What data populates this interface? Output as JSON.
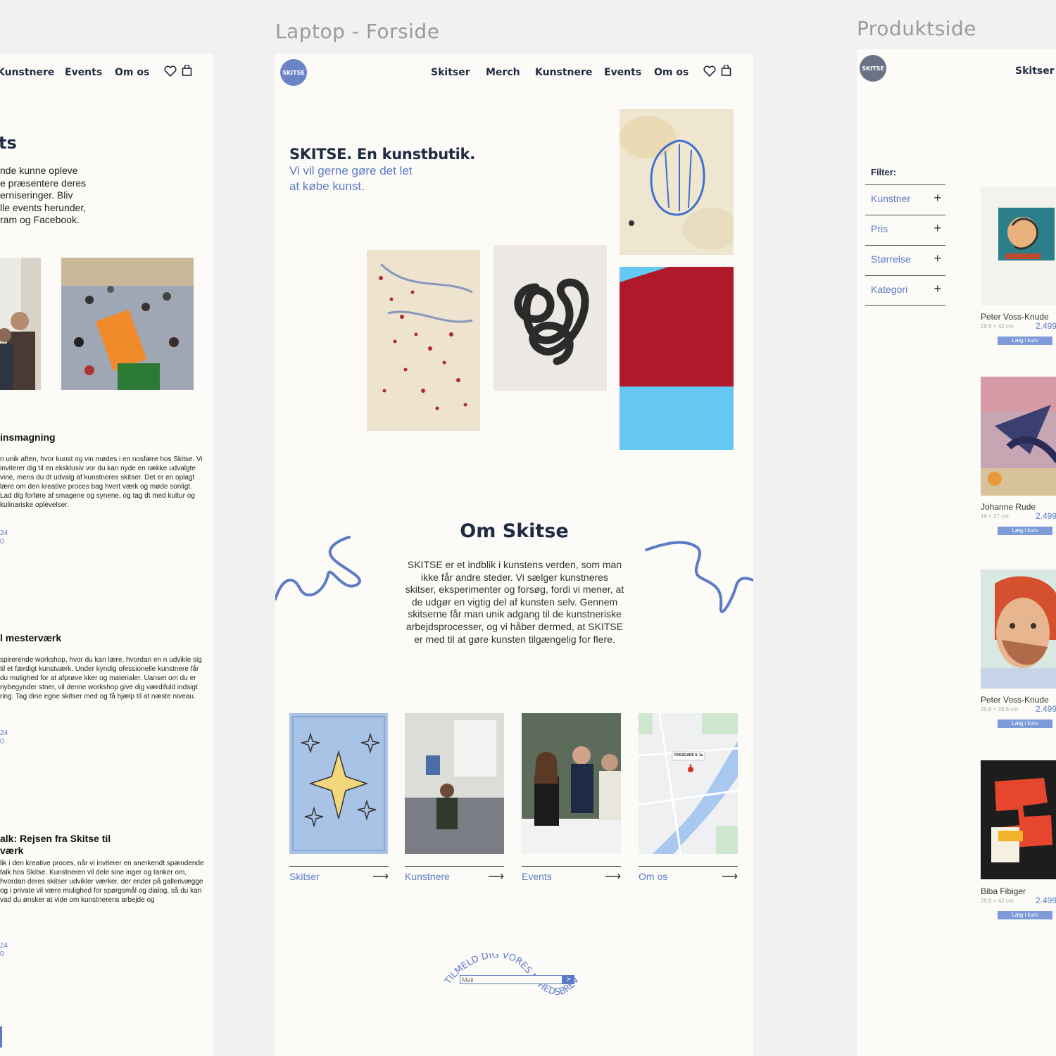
{
  "frames": {
    "laptop_title": "Laptop - Forside",
    "product_title": "Produktside"
  },
  "left": {
    "nav": {
      "kunstnere": "Kunstnere",
      "events": "Events",
      "omos": "Om os"
    },
    "heading": "ts",
    "intro": [
      "nde kunne opleve",
      "e præsentere deres",
      "erniseringer.  Bliv",
      "lle events herunder,",
      "ram og Facebook."
    ],
    "events": [
      {
        "title": "insmagning",
        "body": "n unik aften, hvor kunst og vin mødes i en nosfære hos Skitse. Vi inviterer dig til en eksklusiv vor du kan nyde en række udvalgte vine, mens du dt udvalg af kunstneres skitser. Det er en oplagt lære om den kreative proces bag hvert værk og møde sonligt. Lad dig forføre af smagene og synene, og tag dt med kultur og kulinariske oplevelser.",
        "date1": "24",
        "date2": "0"
      },
      {
        "title": "l mesterværk",
        "body": "spirerende workshop, hvor du kan lære, hvordan en n udvikle sig til et færdigt kunstværk. Under kyndig ofessionelle kunstnere får du mulighed for at afprøve kker og materialer. Uanset om du er nybegynder stner, vil denne workshop give dig værdifuld indsigt ring. Tag dine egne skitser med og få hjælp til at næste niveau.",
        "date1": "24",
        "date2": "0"
      },
      {
        "title": "alk: Rejsen fra Skitse til",
        "title2": "værk",
        "body": "lik i den kreative proces, når vi inviterer en anerkendt spændende talk hos Skitse. Kunstneren vil dele sine inger og tanker om, hvordan deres skitser udvikler værker, der ender på gallerivægge og i private vil være mulighed for spørgsmål og dialog, så du kan vad du ønsker at vide om kunstnerens arbejde og",
        "date1": "24",
        "date2": "0"
      }
    ]
  },
  "mid": {
    "logo": "SKITSE",
    "nav": {
      "skitser": "Skitser",
      "merch": "Merch",
      "kunstnere": "Kunstnere",
      "events": "Events",
      "omos": "Om os"
    },
    "hero_title": "SKITSE. En kunstbutik.",
    "hero_sub1": "Vi vil gerne gøre det let",
    "hero_sub2": "at købe kunst.",
    "about_title": "Om Skitse",
    "about_lines": [
      "SKITSE er et indblik i kunstens verden, som man",
      "ikke får andre steder. Vi sælger kunstneres",
      "skitser, eksperimenter og forsøg, fordi vi mener, at",
      "de udgør en vigtig del af kunsten selv. Gennem",
      "skitserne får man unik adgang til de kunstneriske",
      "arbejdsprocesser, og vi håber dermed, at SKITSE",
      "er med til at gøre kunsten tilgængelig for flere."
    ],
    "cards": [
      "Skitser",
      "Kunstnere",
      "Events",
      "Om os"
    ],
    "arrow": "⟶",
    "map_label": "RYESGADE 9, 1v",
    "newsletter_arc": "TILMELD DIG VORES NYHEDSBREV",
    "newsletter_placeholder": "Mail",
    "newsletter_go": ">"
  },
  "right": {
    "logo": "SKITSE",
    "nav_skitser": "Skitser",
    "filter_label": "Filter:",
    "filters": [
      "Kunstner",
      "Pris",
      "Størrelse",
      "Kategori"
    ],
    "plus": "+",
    "products": [
      {
        "name": "Peter Voss-Knude",
        "size": "29,6 × 42 cm",
        "price": "2.499",
        "btn": "Læg i kurv"
      },
      {
        "name": "Johanne Rude",
        "size": "19 × 27 cm",
        "price": "2.499",
        "btn": "Læg i kurv"
      },
      {
        "name": "Peter Voss-Knude",
        "size": "20,9 × 29,6 cm",
        "price": "2.499",
        "btn": "Læg i kurv"
      },
      {
        "name": "Biba Fibiger",
        "size": "29,6 × 42 cm",
        "price": "2.499",
        "btn": "Læg i kurv"
      }
    ]
  },
  "colors": {
    "accent": "#5b7bc6",
    "bg": "#fdfbf7",
    "navy": "#1f2a44"
  }
}
